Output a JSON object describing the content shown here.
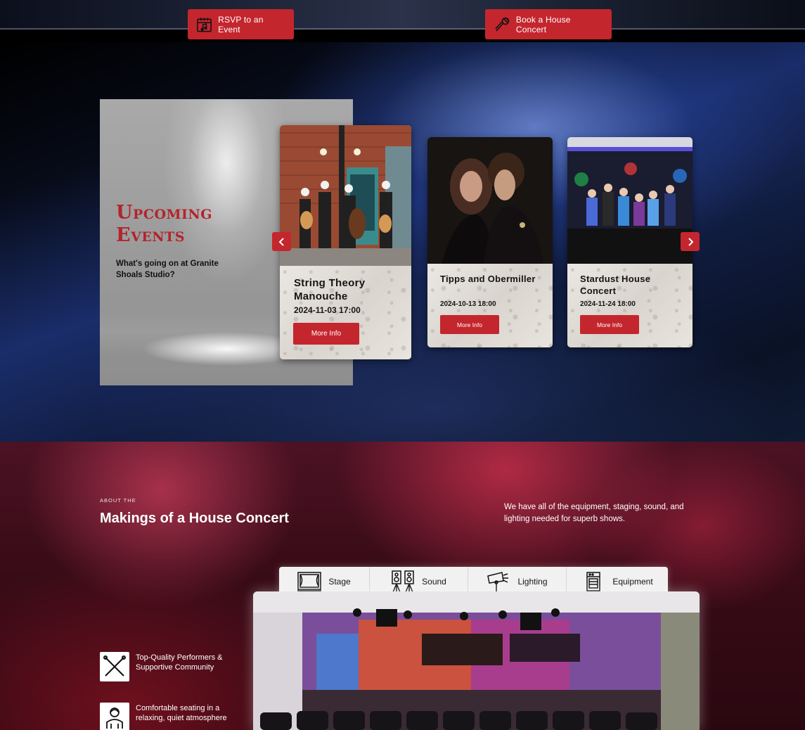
{
  "header": {
    "rsvp_label": "RSVP to an Event",
    "book_label": "Book a House Concert"
  },
  "events": {
    "title": "Upcoming Events",
    "subtitle": "What's going on at Granite Shoals Studio?",
    "cards": [
      {
        "title": "String Theory Manouche",
        "date": "2024-11-03 17:00",
        "button": "More Info"
      },
      {
        "title": "Tipps and Obermiller",
        "date": "2024-10-13 18:00",
        "button": "More Info"
      },
      {
        "title": "Stardust House Concert",
        "date": "2024-11-24 18:00",
        "button": "More Info"
      }
    ]
  },
  "makings": {
    "kicker": "ABOUT THE",
    "title": "Makings of a House Concert",
    "description": "We have all of the equipment, staging, sound, and lighting needed for superb shows.",
    "tabs": [
      {
        "label": "Stage",
        "icon": "stage-icon"
      },
      {
        "label": "Sound",
        "icon": "speakers-icon"
      },
      {
        "label": "Lighting",
        "icon": "spotlight-icon"
      },
      {
        "label": "Equipment",
        "icon": "amplifier-icon"
      }
    ],
    "features": [
      {
        "text": "Top-Quality Performers & Supportive Community",
        "icon": "crossed-drumsticks-icon"
      },
      {
        "text": "Comfortable seating in a relaxing, quiet atmosphere",
        "icon": "audience-person-icon"
      }
    ]
  },
  "colors": {
    "accent": "#c4262e",
    "title_red": "#b3242b",
    "blue_glow": "#1a2d6a",
    "makings_bg": "#4c1224"
  }
}
